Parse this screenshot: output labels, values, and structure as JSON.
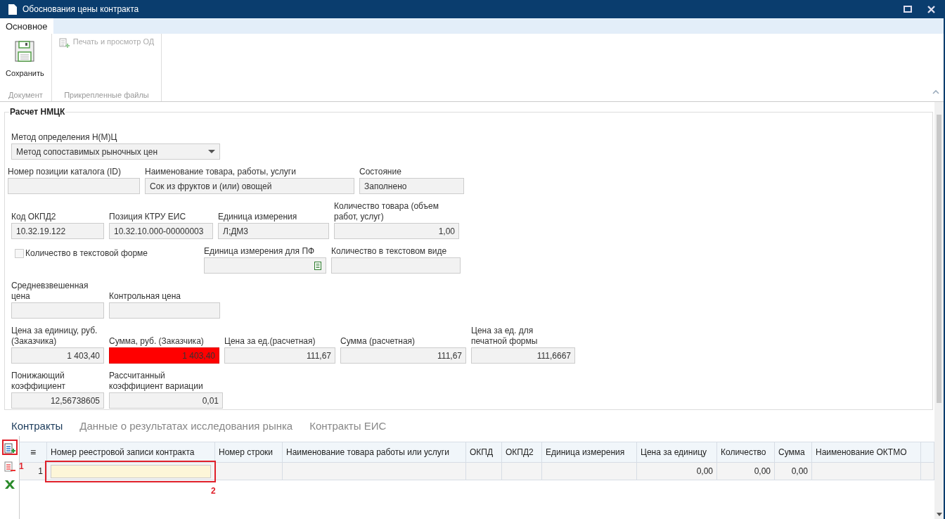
{
  "window": {
    "title": "Обоснования цены контракта"
  },
  "ribbon_tabs": [
    {
      "label": "Основное",
      "selected": true
    }
  ],
  "ribbon_groups": [
    {
      "caption": "Документ",
      "buttons": [
        {
          "label": "Сохранить",
          "kind": "large",
          "disabled": false
        }
      ]
    },
    {
      "caption": "Прикрепленные файлы",
      "buttons": [
        {
          "label": "Печать и просмотр ОД",
          "kind": "small",
          "disabled": true
        }
      ]
    }
  ],
  "form": {
    "title": "Расчет НМЦК",
    "rows": [
      [
        {
          "kind": "select",
          "label": "Метод определения Н(М)Ц",
          "value": "Метод сопоставимых рыночных цен"
        }
      ],
      [
        {
          "kind": "text",
          "label": "Номер позиции каталога (ID)"
        },
        {
          "kind": "text",
          "label": "Наименование товара, работы, услуги",
          "value": "Сок из фруктов и (или) овощей"
        },
        {
          "kind": "text",
          "label": "Состояние",
          "value": "Заполнено"
        }
      ],
      [
        {
          "kind": "text",
          "label": "Код ОКПД2",
          "value": "10.32.19.122"
        },
        {
          "kind": "text",
          "label": "Позиция КТРУ ЕИС",
          "value": "10.32.10.000-00000003"
        },
        {
          "kind": "text",
          "label": "Единица измерения",
          "value": "Л;ДМ3"
        },
        {
          "kind": "number",
          "label": "Количество товара (объем работ, услуг)",
          "value": "1,00",
          "invalid": false
        }
      ],
      [
        {
          "kind": "checkbox",
          "label": "Количество в текстовой форме",
          "checked": false
        },
        {
          "kind": "picker",
          "label": "Единица измерения для ПФ"
        },
        {
          "kind": "text",
          "label": "Количество в текстовом виде"
        }
      ],
      [
        {
          "kind": "text",
          "label": "Средневзвешенная цена"
        },
        {
          "kind": "text",
          "label": "Контрольная цена"
        }
      ],
      [
        {
          "kind": "number",
          "label": "Цена за единицу, руб. (Заказчика)",
          "value": "1 403,40",
          "invalid": false
        },
        {
          "kind": "number",
          "label": "Сумма, руб. (Заказчика)",
          "value": "1 403,40",
          "invalid": true
        },
        {
          "kind": "number",
          "label": "Цена за ед.(расчетная)",
          "value": "111,67",
          "invalid": false
        },
        {
          "kind": "number",
          "label": "Сумма (расчетная)",
          "value": "111,67",
          "invalid": false
        },
        {
          "kind": "number",
          "label": "Цена за ед. для печатной формы",
          "value": "111,6667",
          "invalid": false
        }
      ],
      [
        {
          "kind": "number",
          "label": "Понижающий коэффициент",
          "value": "12,56738605",
          "invalid": false
        },
        {
          "kind": "number",
          "label": "Рассчитанный коэффициент вариации",
          "value": "0,01",
          "invalid": false
        }
      ]
    ]
  },
  "tabs": [
    {
      "label": "Контракты",
      "selected": true
    },
    {
      "label": "Данные о результатах исследования рынка",
      "selected": false
    },
    {
      "label": "Контракты ЕИС",
      "selected": false
    }
  ],
  "table": {
    "columns": [
      {
        "label": "≡",
        "kind": "index"
      },
      {
        "label": "Номер реестровой записи контракта",
        "kind": "text"
      },
      {
        "label": "Номер строки",
        "kind": "text"
      },
      {
        "label": "Наименование товара работы или услуги",
        "kind": "text"
      },
      {
        "label": "ОКПД",
        "kind": "text"
      },
      {
        "label": "ОКПД2",
        "kind": "text"
      },
      {
        "label": "Единица измерения",
        "kind": "text"
      },
      {
        "label": "Цена за единицу",
        "kind": "number"
      },
      {
        "label": "Количество",
        "kind": "number"
      },
      {
        "label": "Сумма",
        "kind": "number"
      },
      {
        "label": "Наименование ОКТМО",
        "kind": "text"
      }
    ],
    "rows": [
      {
        "editing": true,
        "cells": [
          "1",
          "",
          "",
          "",
          "",
          "",
          "",
          "0,00",
          "0,00",
          "0,00",
          ""
        ]
      }
    ]
  },
  "annotations": [
    {
      "label": "1"
    },
    {
      "label": "2"
    }
  ]
}
